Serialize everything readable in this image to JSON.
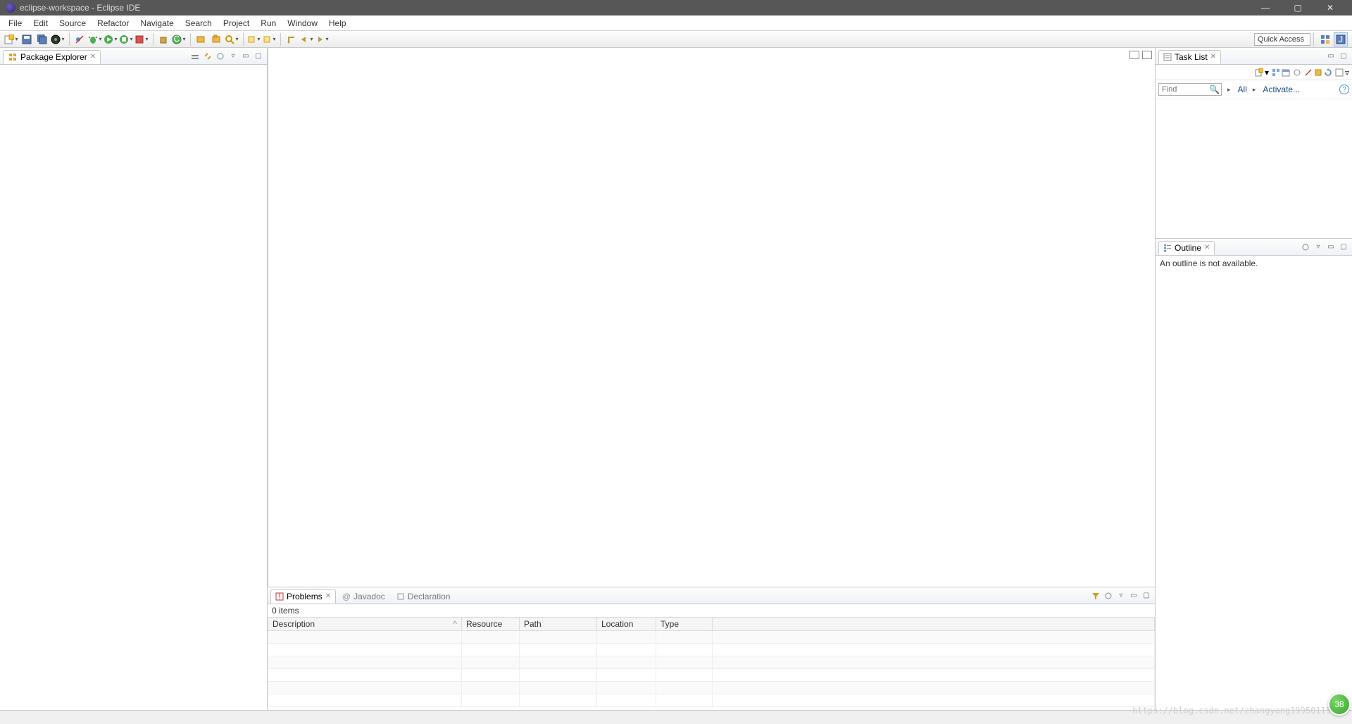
{
  "titlebar": {
    "title": "eclipse-workspace - Eclipse IDE"
  },
  "menubar": {
    "items": [
      "File",
      "Edit",
      "Source",
      "Refactor",
      "Navigate",
      "Search",
      "Project",
      "Run",
      "Window",
      "Help"
    ]
  },
  "toolbar": {
    "quick_access": "Quick Access"
  },
  "package_explorer": {
    "title": "Package Explorer"
  },
  "task_list": {
    "title": "Task List",
    "find_placeholder": "Find",
    "all_link": "All",
    "activate_link": "Activate..."
  },
  "outline": {
    "title": "Outline",
    "empty_msg": "An outline is not available."
  },
  "problems": {
    "tabs": {
      "problems": "Problems",
      "javadoc": "Javadoc",
      "declaration": "Declaration"
    },
    "count": "0 items",
    "columns": [
      "Description",
      "Resource",
      "Path",
      "Location",
      "Type"
    ]
  },
  "badge": {
    "count": "38"
  },
  "watermark": "https://blog.csdn.net/zhangyang19950115"
}
